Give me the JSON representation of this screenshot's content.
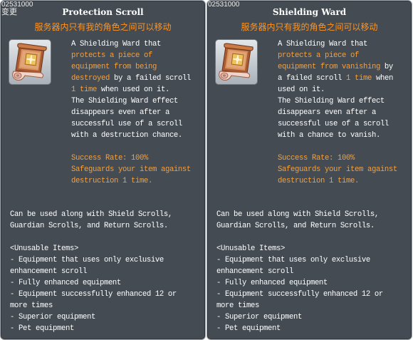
{
  "tooltips": [
    {
      "item_id": "02531000",
      "change_tag": "变更",
      "title": "Protection Scroll",
      "trade_note": "服务器内只有我的角色之间可以移动",
      "icon": "scroll-icon",
      "description_lines": [
        [
          {
            "text": "A Shielding Ward that"
          }
        ],
        [
          {
            "text": "protects a piece of",
            "highlight": true
          }
        ],
        [
          {
            "text": "equipment from being",
            "highlight": true
          }
        ],
        [
          {
            "text": "destroyed",
            "highlight": true
          },
          {
            "text": " by a failed scroll"
          }
        ],
        [
          {
            "text": "1 time",
            "highlight": true
          },
          {
            "text": " when used on it."
          }
        ],
        [
          {
            "text": "The Shielding Ward effect"
          }
        ],
        [
          {
            "text": "disappears even after a"
          }
        ],
        [
          {
            "text": "successful use of a scroll"
          }
        ],
        [
          {
            "text": "with a destruction chance."
          }
        ]
      ],
      "effect_lines": [
        "Success Rate: 100%",
        "Safeguards your item against",
        "destruction 1 time."
      ],
      "usage_lines": [
        "Can be used along with Shield Scrolls,",
        "Guardian Scrolls, and Return Scrolls."
      ],
      "unusable_header": "<Unusable Items>",
      "unusable_lines": [
        "- Equipment that uses only exclusive",
        "enhancement scroll",
        "- Fully enhanced equipment",
        "- Equipment successfully enhanced 12 or",
        "more times",
        "- Superior equipment",
        "- Pet equipment"
      ]
    },
    {
      "item_id": "02531000",
      "title": "Shielding Ward",
      "trade_note": "服务器内只有我的角色之间可以移动",
      "icon": "scroll-icon",
      "description_lines": [
        [
          {
            "text": "A Shielding Ward that"
          }
        ],
        [
          {
            "text": "protects a piece of",
            "highlight": true
          }
        ],
        [
          {
            "text": "equipment from vanishing",
            "highlight": true
          },
          {
            "text": " by"
          }
        ],
        [
          {
            "text": "a failed scroll "
          },
          {
            "text": "1 time",
            "highlight": true
          },
          {
            "text": " when"
          }
        ],
        [
          {
            "text": "used on it."
          }
        ],
        [
          {
            "text": "The Shielding Ward effect"
          }
        ],
        [
          {
            "text": "disappears even after a"
          }
        ],
        [
          {
            "text": "successful use of a scroll"
          }
        ],
        [
          {
            "text": "with a chance to vanish."
          }
        ]
      ],
      "effect_lines": [
        "Success Rate: 100%",
        "Safeguards your item against",
        "destruction 1 time."
      ],
      "usage_lines": [
        "Can be used along with Shield Scrolls,",
        "Guardian Scrolls, and Return Scrolls."
      ],
      "unusable_header": "<Unusable Items>",
      "unusable_lines": [
        "- Equipment that uses only exclusive",
        "enhancement scroll",
        "- Fully enhanced equipment",
        "- Equipment successfully enhanced 12 or",
        "more times",
        "- Superior equipment",
        "- Pet equipment"
      ]
    }
  ],
  "colors": {
    "panel_background": "#444b52",
    "panel_border": "#a3a9af",
    "text_normal": "#ffffff",
    "text_highlight": "#f5a03c",
    "trade_note": "#ff9422"
  }
}
